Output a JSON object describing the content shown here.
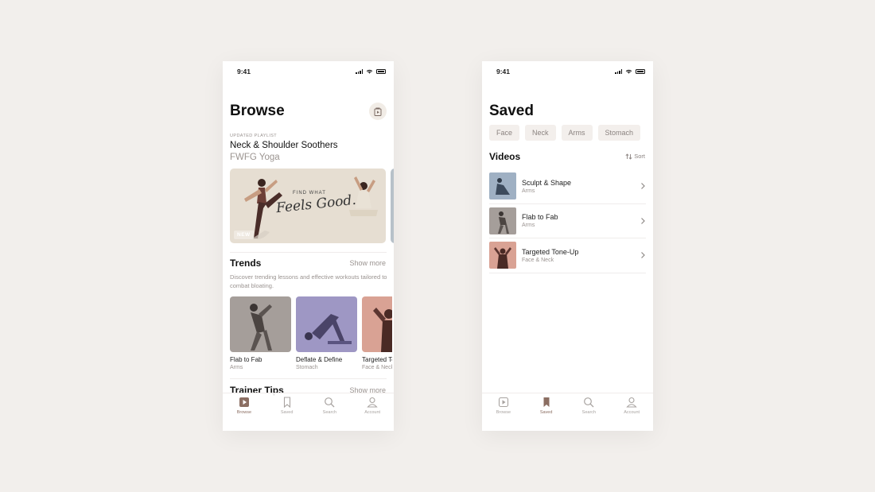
{
  "browse_screen": {
    "status_time": "9:41",
    "title": "Browse",
    "playlist": {
      "eyebrow": "UPDATED PLAYLIST",
      "name": "Neck & Shoulder Soothers",
      "trainer": "FWFG Yoga",
      "banner_line1": "FIND WHAT",
      "banner_line2": "Feels Good.",
      "badge": "NEW"
    },
    "trends": {
      "title": "Trends",
      "show_more": "Show more",
      "description": "Discover trending lessons and effective workouts tailored to combat bloating.",
      "cards": [
        {
          "title": "Flab to Fab",
          "subtitle": "Arms",
          "color": "#a59e9a"
        },
        {
          "title": "Deflate & Define",
          "subtitle": "Stomach",
          "color": "#9e97c4"
        },
        {
          "title": "Targeted Tone-Up",
          "subtitle": "Face & Neck",
          "color": "#d9a294"
        }
      ]
    },
    "trainer_tips": {
      "title": "Trainer Tips",
      "show_more": "Show more"
    },
    "tabs": [
      {
        "label": "Browse",
        "icon": "play-square-icon",
        "active": true
      },
      {
        "label": "Saved",
        "icon": "bookmark-icon",
        "active": false
      },
      {
        "label": "Search",
        "icon": "search-icon",
        "active": false
      },
      {
        "label": "Account",
        "icon": "person-icon",
        "active": false
      }
    ]
  },
  "saved_screen": {
    "status_time": "9:41",
    "title": "Saved",
    "chips": [
      "Face",
      "Neck",
      "Arms",
      "Stomach"
    ],
    "videos_title": "Videos",
    "sort_label": "Sort",
    "videos": [
      {
        "title": "Sculpt & Shape",
        "subtitle": "Arms",
        "color": "#9fb0c3"
      },
      {
        "title": "Flab to Fab",
        "subtitle": "Arms",
        "color": "#a59e9a"
      },
      {
        "title": "Targeted Tone-Up",
        "subtitle": "Face & Neck",
        "color": "#d9a294"
      }
    ],
    "tabs": [
      {
        "label": "Browse",
        "icon": "play-square-icon",
        "active": false
      },
      {
        "label": "Saved",
        "icon": "bookmark-icon",
        "active": true
      },
      {
        "label": "Search",
        "icon": "search-icon",
        "active": false
      },
      {
        "label": "Account",
        "icon": "person-icon",
        "active": false
      }
    ]
  },
  "colors": {
    "accent": "#8b6e62",
    "muted_text": "#9a9390",
    "background": "#f2efec"
  }
}
